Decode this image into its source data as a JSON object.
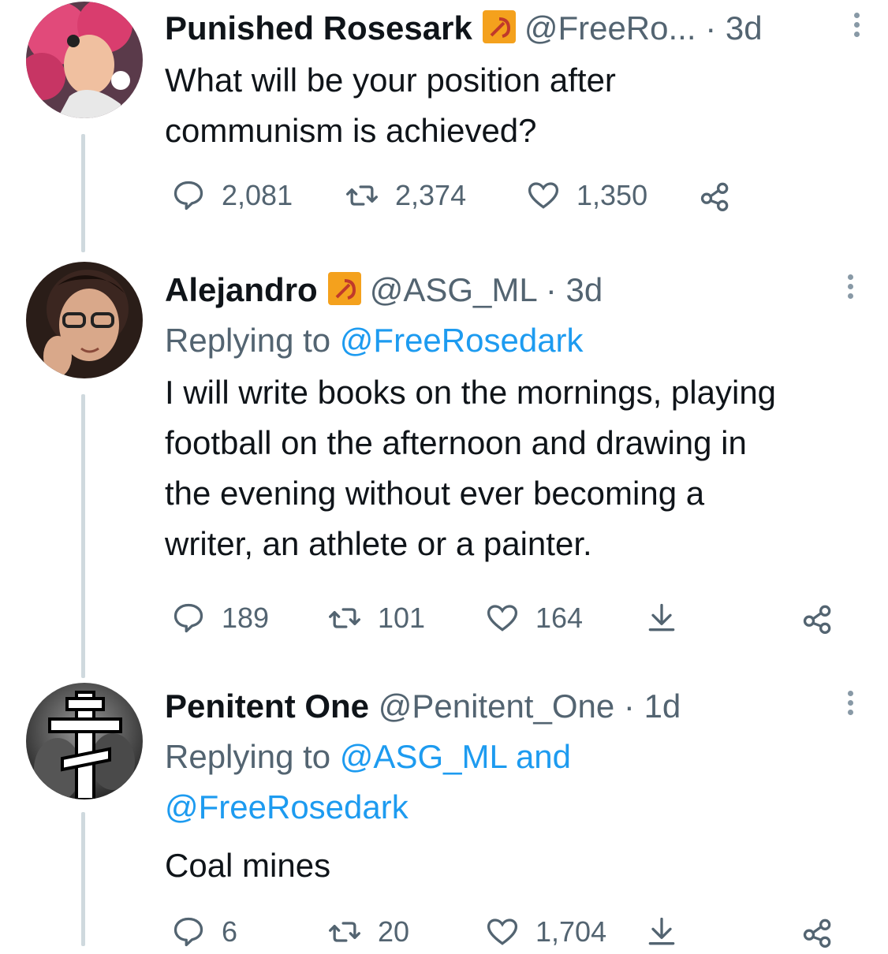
{
  "tweets": [
    {
      "name": "Punished Rosesark",
      "handle": "@FreeRo...",
      "dot": "·",
      "time": "3d",
      "text_lines": [
        "What will be your position after",
        "communism is achieved?"
      ],
      "replies": "2,081",
      "retweets": "2,374",
      "likes": "1,350"
    },
    {
      "name": "Alejandro",
      "handle": "@ASG_ML",
      "dot": "·",
      "time": "3d",
      "replying_prefix": "Replying to ",
      "replying_to": "@FreeRosedark",
      "text_lines": [
        "I will write books on the mornings, playing",
        "football on the afternoon and drawing in",
        "the evening without ever becoming a",
        "writer, an athlete or a painter."
      ],
      "replies": "189",
      "retweets": "101",
      "likes": "164"
    },
    {
      "name": "Penitent One",
      "handle": "@Penitent_One",
      "dot": "·",
      "time": "1d",
      "replying_prefix": "Replying to ",
      "replying_to_1": "@ASG_ML",
      "replying_and": " and",
      "replying_to_2": "@FreeRosedark",
      "text_lines": [
        "Coal mines"
      ],
      "replies": "6",
      "retweets": "20",
      "likes": "1,704"
    }
  ],
  "colors": {
    "accent": "#1d9bf0",
    "muted": "#536471",
    "badge": "#f4a11d",
    "line": "#cfd9de"
  }
}
